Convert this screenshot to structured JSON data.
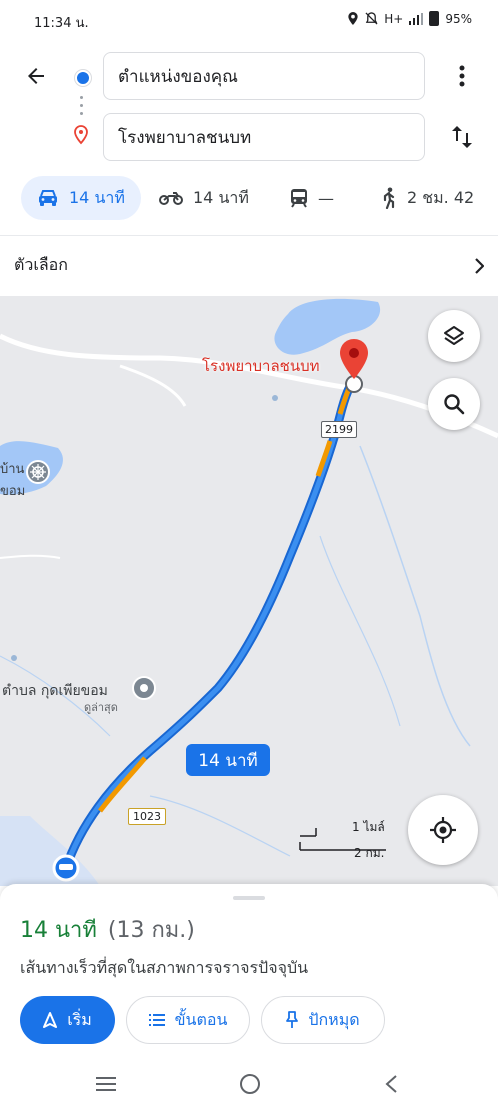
{
  "status_bar": {
    "time": "11:34 น.",
    "network": "H+",
    "battery": "95%"
  },
  "route": {
    "origin": "ตำแหน่งของคุณ",
    "destination": "โรงพยาบาลชนบท"
  },
  "modes": [
    {
      "icon": "car-icon",
      "label": "14 นาที",
      "active": true
    },
    {
      "icon": "motorcycle-icon",
      "label": "14 นาที"
    },
    {
      "icon": "transit-icon",
      "label": "—"
    },
    {
      "icon": "walk-icon",
      "label": "2 ชม. 42"
    }
  ],
  "options_label": "ตัวเลือก",
  "map": {
    "destination_label": "โรงพยาบาลชนบท",
    "road_shield_1": "2199",
    "road_shield_2": "1023",
    "place_left_line1": "บ้าน",
    "place_left_line2": "ขอม",
    "place_mid_line1": "ตำบล กุดเพียขอม",
    "place_mid_line2": "ดูล่าสุด",
    "route_bubble": "14 นาที",
    "scale_top": "1 ไมล์",
    "scale_bottom": "2 กม."
  },
  "sheet": {
    "duration": "14 นาที",
    "distance": "(13 กม.)",
    "description": "เส้นทางเร็วที่สุดในสภาพการจราจรปัจจุบัน",
    "start_label": "เริ่ม",
    "steps_label": "ขั้นตอน",
    "pin_label": "ปักหมุด"
  },
  "colors": {
    "accent": "#1a73e8",
    "route": "#1a73e8",
    "traffic": "#f29900",
    "green": "#188038",
    "pin": "#ea4335"
  }
}
